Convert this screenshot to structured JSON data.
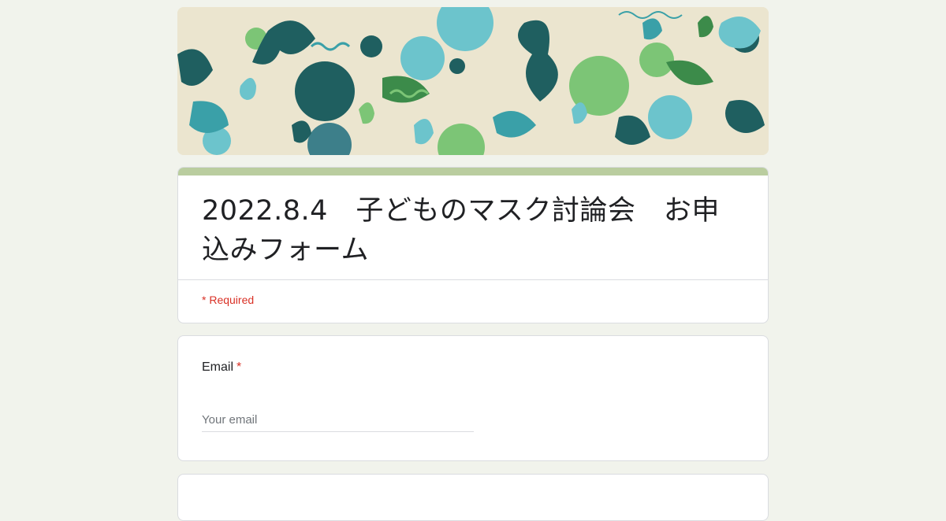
{
  "form": {
    "title": "2022.8.4　子どものマスク討論会　お申込みフォーム",
    "required_note": "* Required",
    "accent_color": "#bacd9f"
  },
  "banner": {
    "description_icon": "ocean-pattern-banner",
    "colors": [
      "#1f5f60",
      "#3aa0a8",
      "#6cc4cc",
      "#7cc576",
      "#ebe5cf"
    ]
  },
  "questions": [
    {
      "label": "Email",
      "required_marker": "*",
      "placeholder": "Your email",
      "value": ""
    }
  ]
}
